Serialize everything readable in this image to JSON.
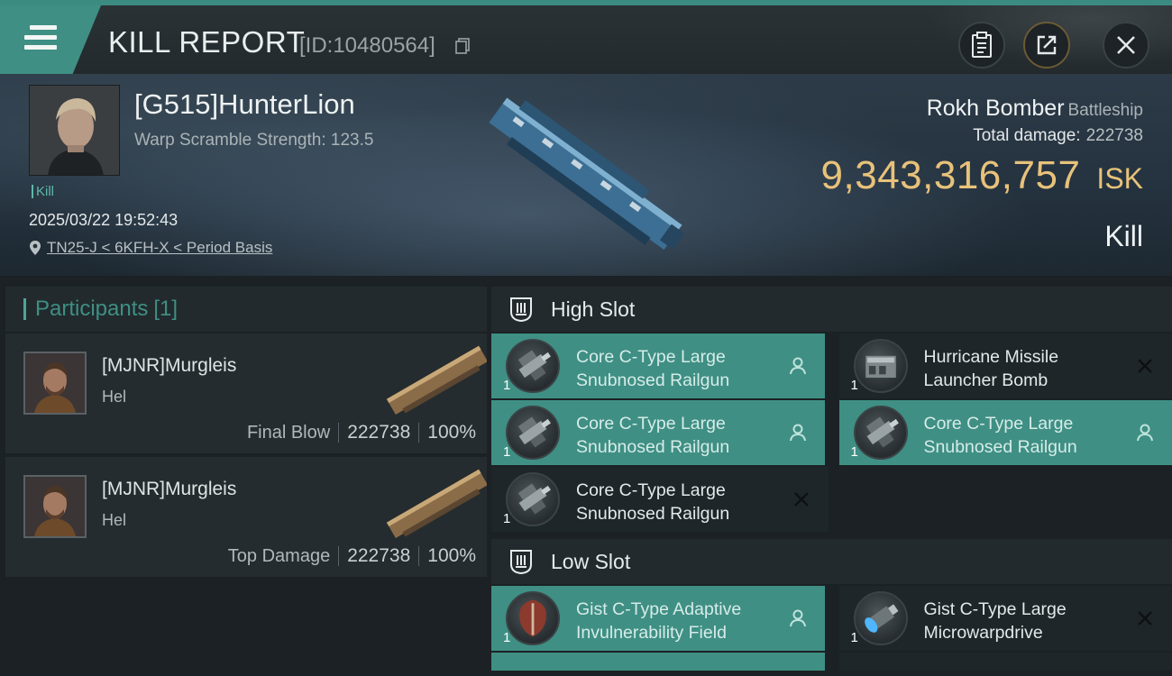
{
  "header": {
    "title": "KILL REPORT",
    "report_id": "[ID:10480564]"
  },
  "victim": {
    "name": "[G515]HunterLion",
    "warp_scramble": "Warp Scramble Strength: 123.5",
    "tag": "Kill",
    "timestamp": "2025/03/22 19:52:43",
    "location": "TN25-J < 6KFH-X < Period Basis",
    "ship_name": "Rokh Bomber",
    "ship_class": "Battleship",
    "total_damage_label": "Total damage:",
    "total_damage": "222738",
    "isk_value": "9,343,316,757",
    "isk_unit": "ISK",
    "result": "Kill"
  },
  "participants": {
    "label": "Participants",
    "count": "[1]",
    "items": [
      {
        "name": "[MJNR]Murgleis",
        "ship": "Hel",
        "role": "Final Blow",
        "damage": "222738",
        "percent": "100%"
      },
      {
        "name": "[MJNR]Murgleis",
        "ship": "Hel",
        "role": "Top Damage",
        "damage": "222738",
        "percent": "100%"
      }
    ]
  },
  "fitting": {
    "high_slot": {
      "label": "High Slot",
      "modules": [
        {
          "name": "Core C-Type Large Snubnosed Railgun",
          "qty": "1",
          "status": "person-icon",
          "active": true
        },
        {
          "name": "Hurricane Missile Launcher Bomb",
          "qty": "1",
          "status": "close-icon",
          "active": false
        },
        {
          "name": "Core C-Type Large Snubnosed Railgun",
          "qty": "1",
          "status": "person-icon",
          "active": true
        },
        {
          "name": "Core C-Type Large Snubnosed Railgun",
          "qty": "1",
          "status": "person-icon",
          "active": true
        },
        {
          "name": "Core C-Type Large Snubnosed Railgun",
          "qty": "1",
          "status": "close-icon",
          "active": false
        }
      ]
    },
    "low_slot": {
      "label": "Low Slot",
      "modules": [
        {
          "name": "Gist C-Type Adaptive Invulnerability Field",
          "qty": "1",
          "status": "person-icon",
          "active": true
        },
        {
          "name": "Gist C-Type Large Microwarpdrive",
          "qty": "1",
          "status": "close-icon",
          "active": false
        }
      ]
    }
  },
  "colors": {
    "accent": "#3f8f84",
    "isk_gold": "#e8c27a",
    "panel": "#252c2f"
  }
}
